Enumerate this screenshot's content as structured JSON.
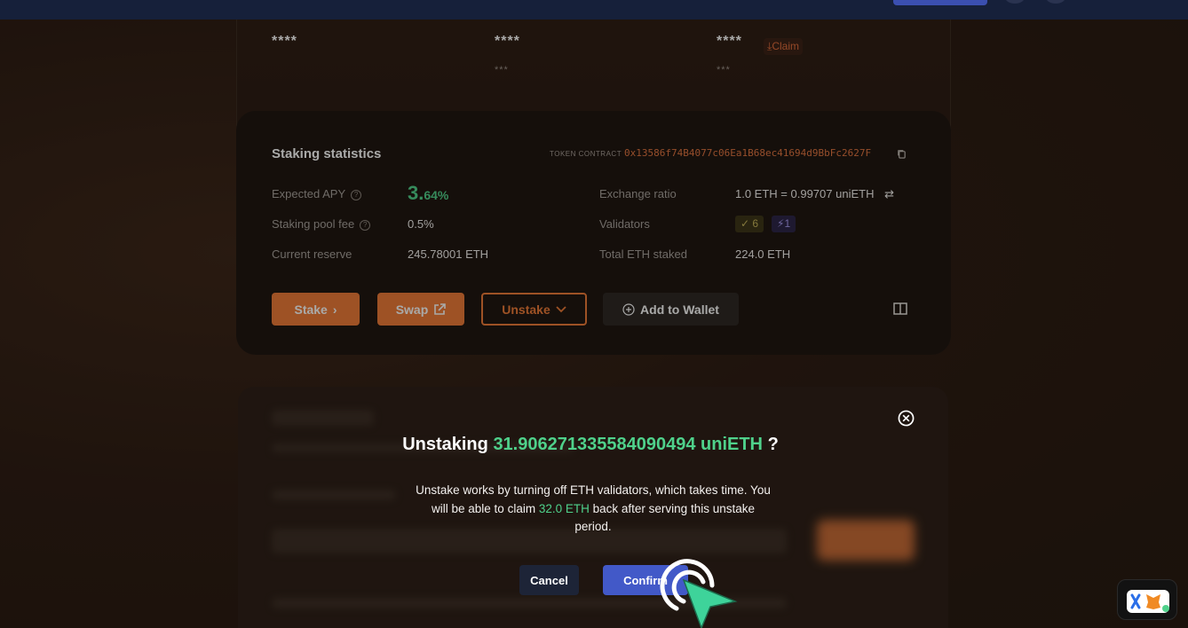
{
  "summary": {
    "col1_value": "****",
    "col2_value": "****",
    "col2_sub": "***",
    "col3_value": "****",
    "col3_sub": "***",
    "claim_label": "Claim"
  },
  "stats": {
    "title": "Staking statistics",
    "token_contract_label": "TOKEN CONTRACT",
    "token_contract_address": "0x13586f74B4077c06Ea1B68ec41694d9BbFc2627F",
    "expected_apy_label": "Expected APY",
    "apy_int": "3.",
    "apy_dec": "64%",
    "pool_fee_label": "Staking pool fee",
    "pool_fee_value": "0.5%",
    "reserve_label": "Current reserve",
    "reserve_value": "245.78001 ETH",
    "exchange_label": "Exchange ratio",
    "exchange_value": "1.0 ETH = 0.99707 uniETH",
    "validators_label": "Validators",
    "validators_active": "6",
    "validators_pending": "1",
    "total_staked_label": "Total ETH staked",
    "total_staked_value": "224.0 ETH"
  },
  "actions": {
    "stake": "Stake",
    "swap": "Swap",
    "unstake": "Unstake",
    "add_wallet": "Add to Wallet"
  },
  "modal": {
    "title_prefix": "Unstaking",
    "title_amount": "31.906271335584090494 uniETH",
    "title_suffix": "?",
    "text_1": "Unstake works by turning off ETH validators, which takes time. You will be able to claim",
    "text_amount": "32.0 ETH",
    "text_2": "back after serving this unstake period.",
    "cancel": "Cancel",
    "confirm": "Confirm"
  },
  "colors": {
    "accent_orange": "#ef7a36",
    "accent_green": "#4fd18b",
    "confirm_blue": "#4259c8"
  }
}
